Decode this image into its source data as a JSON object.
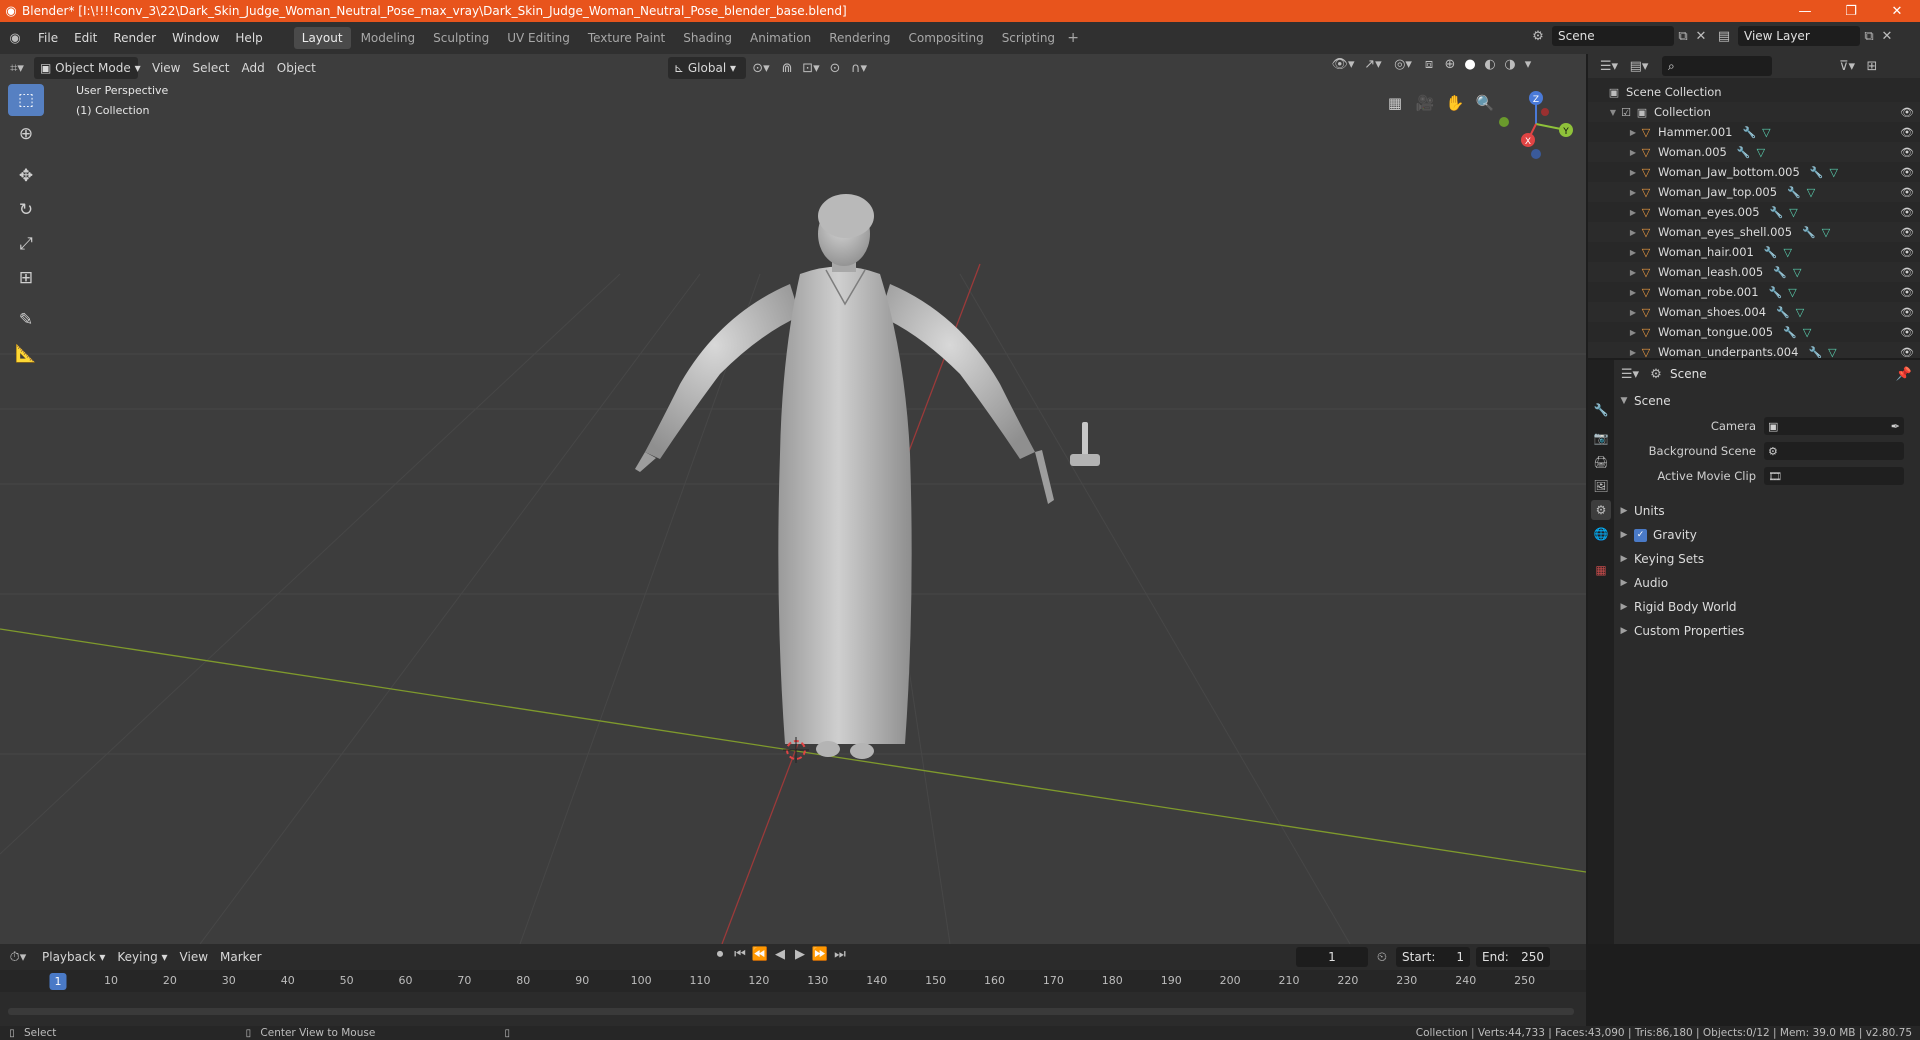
{
  "window": {
    "title": "Blender* [I:\\!!!!conv_3\\22\\Dark_Skin_Judge_Woman_Neutral_Pose_max_vray\\Dark_Skin_Judge_Woman_Neutral_Pose_blender_base.blend]",
    "accent_color": "#e8541c"
  },
  "menu": {
    "items": [
      "File",
      "Edit",
      "Render",
      "Window",
      "Help"
    ]
  },
  "workspaces": {
    "tabs": [
      "Layout",
      "Modeling",
      "Sculpting",
      "UV Editing",
      "Texture Paint",
      "Shading",
      "Animation",
      "Rendering",
      "Compositing",
      "Scripting"
    ],
    "active": "Layout"
  },
  "top_right": {
    "scene": "Scene",
    "view_layer": "View Layer"
  },
  "viewport": {
    "mode": "Object Mode",
    "menus": [
      "View",
      "Select",
      "Add",
      "Object"
    ],
    "orientation": "Global",
    "perspective_label": "User Perspective",
    "collection_label": "(1) Collection",
    "gizmo": {
      "x": "X",
      "y": "Y",
      "z": "Z"
    }
  },
  "outliner": {
    "root": "Scene Collection",
    "collection": "Collection",
    "objects": [
      "Hammer.001",
      "Woman.005",
      "Woman_Jaw_bottom.005",
      "Woman_Jaw_top.005",
      "Woman_eyes.005",
      "Woman_eyes_shell.005",
      "Woman_hair.001",
      "Woman_leash.005",
      "Woman_robe.001",
      "Woman_shoes.004",
      "Woman_tongue.005",
      "Woman_underpants.004"
    ]
  },
  "properties": {
    "context": "Scene",
    "panel_title": "Scene",
    "fields": {
      "camera": "Camera",
      "background_scene": "Background Scene",
      "active_movie_clip": "Active Movie Clip"
    },
    "sections": {
      "units": "Units",
      "gravity": "Gravity",
      "keying_sets": "Keying Sets",
      "audio": "Audio",
      "rigid_body_world": "Rigid Body World",
      "custom_properties": "Custom Properties"
    }
  },
  "timeline": {
    "menus": [
      "Playback",
      "Keying",
      "View",
      "Marker"
    ],
    "current_frame": "1",
    "start_label": "Start:",
    "start": "1",
    "end_label": "End:",
    "end": "250",
    "ruler_current": "1",
    "ruler": [
      "10",
      "20",
      "30",
      "40",
      "50",
      "60",
      "70",
      "80",
      "90",
      "100",
      "110",
      "120",
      "130",
      "140",
      "150",
      "160",
      "170",
      "180",
      "190",
      "200",
      "210",
      "220",
      "230",
      "240",
      "250"
    ]
  },
  "status": {
    "left": "Select",
    "middle": "Center View to Mouse",
    "right": "Collection | Verts:44,733 | Faces:43,090 | Tris:86,180 | Objects:0/12 | Mem: 39.0 MB | v2.80.75"
  }
}
